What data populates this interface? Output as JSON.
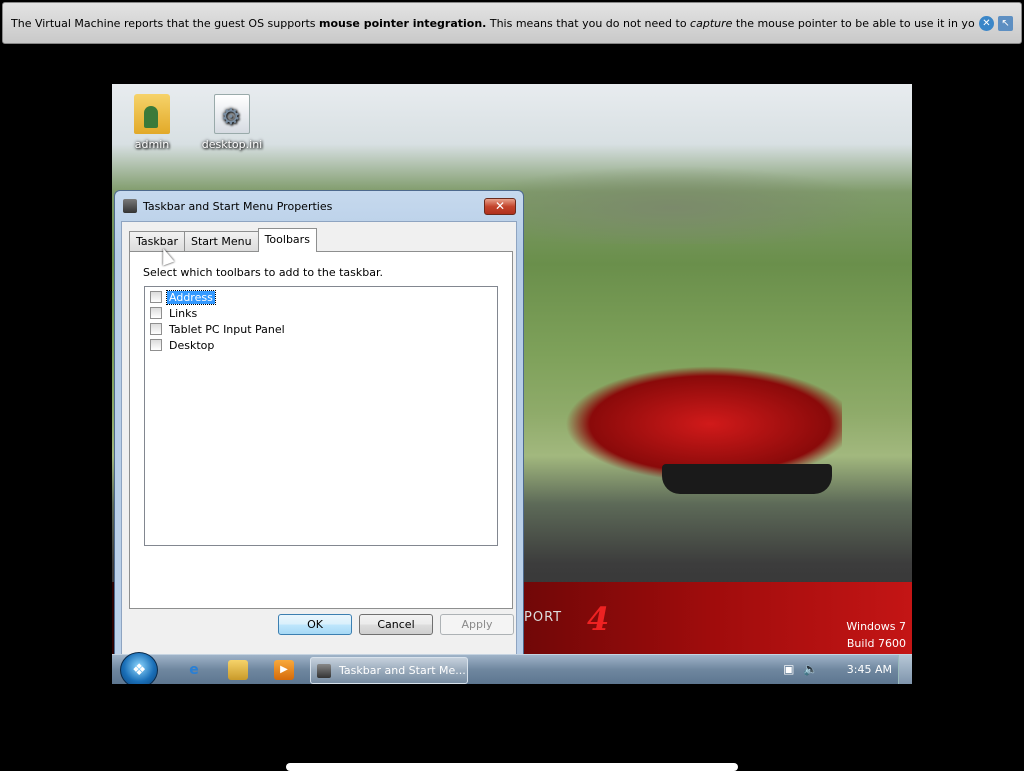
{
  "notification": {
    "text_before": "The Virtual Machine reports that the guest OS supports ",
    "bold": "mouse pointer integration.",
    "text_mid": " This means that you do not need to ",
    "italic": "capture",
    "text_after": " the mouse pointer to be able to use it in your guest OS -- all mouse",
    "close_icon": "close-icon",
    "mouse_icon": "mouse-integration-icon"
  },
  "desktop": {
    "icons": [
      {
        "label": "admin",
        "icon": "user-folder-icon"
      },
      {
        "label": "desktop.ini",
        "icon": "settings-file-icon"
      }
    ],
    "wallpaper_brand": "PORT",
    "wallpaper_brand_number": "4",
    "os_name": "Windows 7",
    "build": "Build 7600"
  },
  "dialog": {
    "title": "Taskbar and Start Menu Properties",
    "close_label": "✕",
    "tabs": [
      {
        "label": "Taskbar",
        "active": false
      },
      {
        "label": "Start Menu",
        "active": false
      },
      {
        "label": "Toolbars",
        "active": true
      }
    ],
    "prompt": "Select which toolbars to add to the taskbar.",
    "toolbars": [
      {
        "label": "Address",
        "checked": false,
        "selected": true
      },
      {
        "label": "Links",
        "checked": false,
        "selected": false
      },
      {
        "label": "Tablet PC Input Panel",
        "checked": false,
        "selected": false
      },
      {
        "label": "Desktop",
        "checked": false,
        "selected": false
      }
    ],
    "buttons": {
      "ok": "OK",
      "cancel": "Cancel",
      "apply": "Apply"
    }
  },
  "taskbar": {
    "pinned": [
      "internet-explorer-icon",
      "windows-explorer-icon",
      "media-player-icon"
    ],
    "active_window": "Taskbar and Start Me...",
    "clock": "3:45 AM",
    "tray_icons": [
      "network-icon",
      "volume-icon"
    ]
  }
}
